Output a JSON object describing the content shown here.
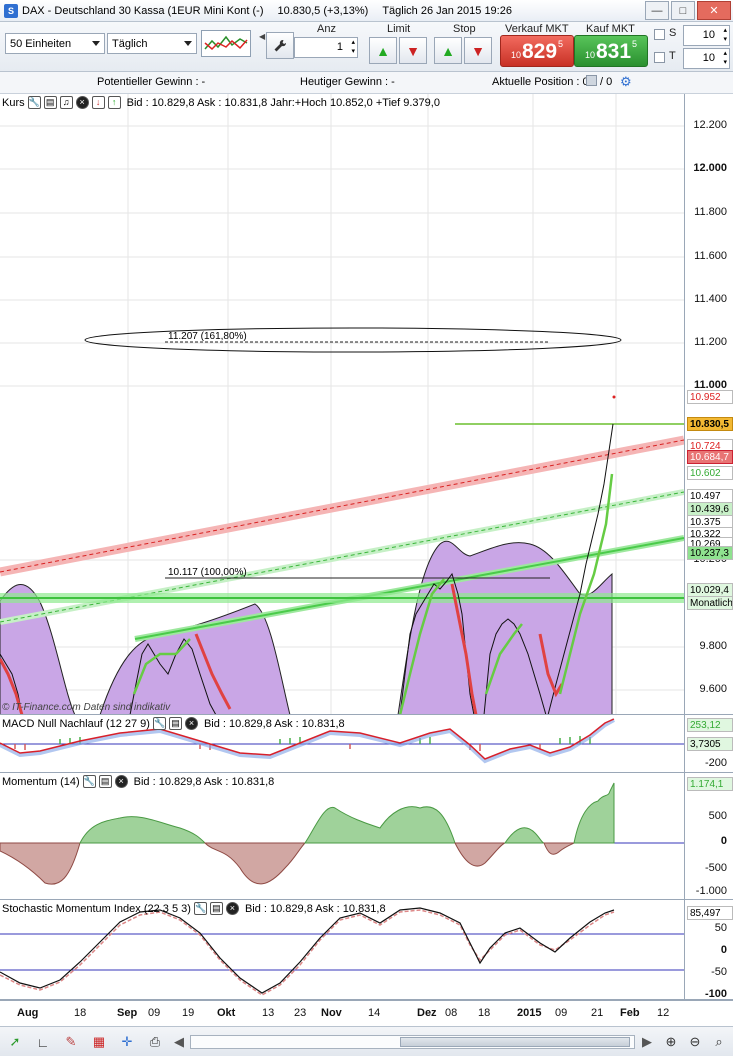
{
  "titlebar": {
    "instrument": "DAX - Deutschland 30 Kassa (1EUR Mini Kont (-)",
    "price": "10.830,5 (+3,13%)",
    "datetime": "Täglich  26 Jan 2015 19:26"
  },
  "toolbar": {
    "units_select": "50 Einheiten",
    "period_select": "Täglich",
    "anz_label": "Anz",
    "anz_value": "1",
    "limit_label": "Limit",
    "stop_label": "Stop",
    "sell_label": "Verkauf MKT",
    "buy_label": "Kauf MKT",
    "sell_prefix": "10",
    "sell_big": "829",
    "sell_sup": "5",
    "buy_prefix": "10",
    "buy_big": "831",
    "buy_sup": "5",
    "s_label": "S",
    "t_label": "T",
    "s_value": "10",
    "t_value": "10"
  },
  "infobar": {
    "potential": "Potentieller Gewinn : -",
    "today": "Heutiger Gewinn : -",
    "position": "Aktuelle Position : 0",
    "position_after": "/ 0"
  },
  "main_panel": {
    "title": "Kurs",
    "info": "Bid : 10.829,8  Ask : 10.831,8  Jahr:+Hoch 10.852,0  +Tief 9.379,0",
    "fib_161": "11.207 (161,80%)",
    "fib_100": "10.117 (100,00%)",
    "watermark": "© IT-Finance.com  Daten sind indikativ",
    "ticks": [
      "12.200",
      "12.000",
      "11.800",
      "11.600",
      "11.400",
      "11.200",
      "11.000",
      "10.200",
      "9.800",
      "9.600"
    ],
    "boxes": {
      "b10952": "10.952",
      "b10830": "10.830,5",
      "b10724": "10.724",
      "b10684": "10.684,7",
      "b10602": "10.602",
      "b10497": "10.497",
      "b10439": "10.439,6",
      "b10375": "10.375",
      "b10322": "10.322",
      "b10269": "10.269",
      "b10237": "10.237,3",
      "b10029": "10.029,4",
      "monat": "Monatliche"
    }
  },
  "macd_panel": {
    "title": "MACD Null Nachlauf (12 27 9)",
    "info": "Bid : 10.829,8  Ask : 10.831,8",
    "val1": "253,12",
    "val2": "3,7305",
    "tick_neg": "-200"
  },
  "momentum_panel": {
    "title": "Momentum (14)",
    "info": "Bid : 10.829,8  Ask : 10.831,8",
    "val": "1.174,1",
    "ticks": [
      "500",
      "0",
      "-500",
      "-1.000"
    ]
  },
  "stoch_panel": {
    "title": "Stochastic Momentum Index (22 3 5 3)",
    "info": "Bid : 10.829,8  Ask : 10.831,8",
    "val": "85,497",
    "ticks": [
      "50",
      "0",
      "-50",
      "-100"
    ]
  },
  "xaxis": [
    "Aug",
    "18",
    "Sep",
    "09",
    "19",
    "Okt",
    "13",
    "23",
    "Nov",
    "14",
    "Dez",
    "08",
    "18",
    "2015",
    "09",
    "21",
    "Feb",
    "12"
  ],
  "colors": {
    "purple_fill": "#c9a6e6",
    "green_line": "#5fd35f",
    "red_line": "#e23a3a",
    "macd_line": "#d8202a",
    "momentum_pos": "#9fd29a",
    "momentum_neg": "#d1a7a3"
  }
}
